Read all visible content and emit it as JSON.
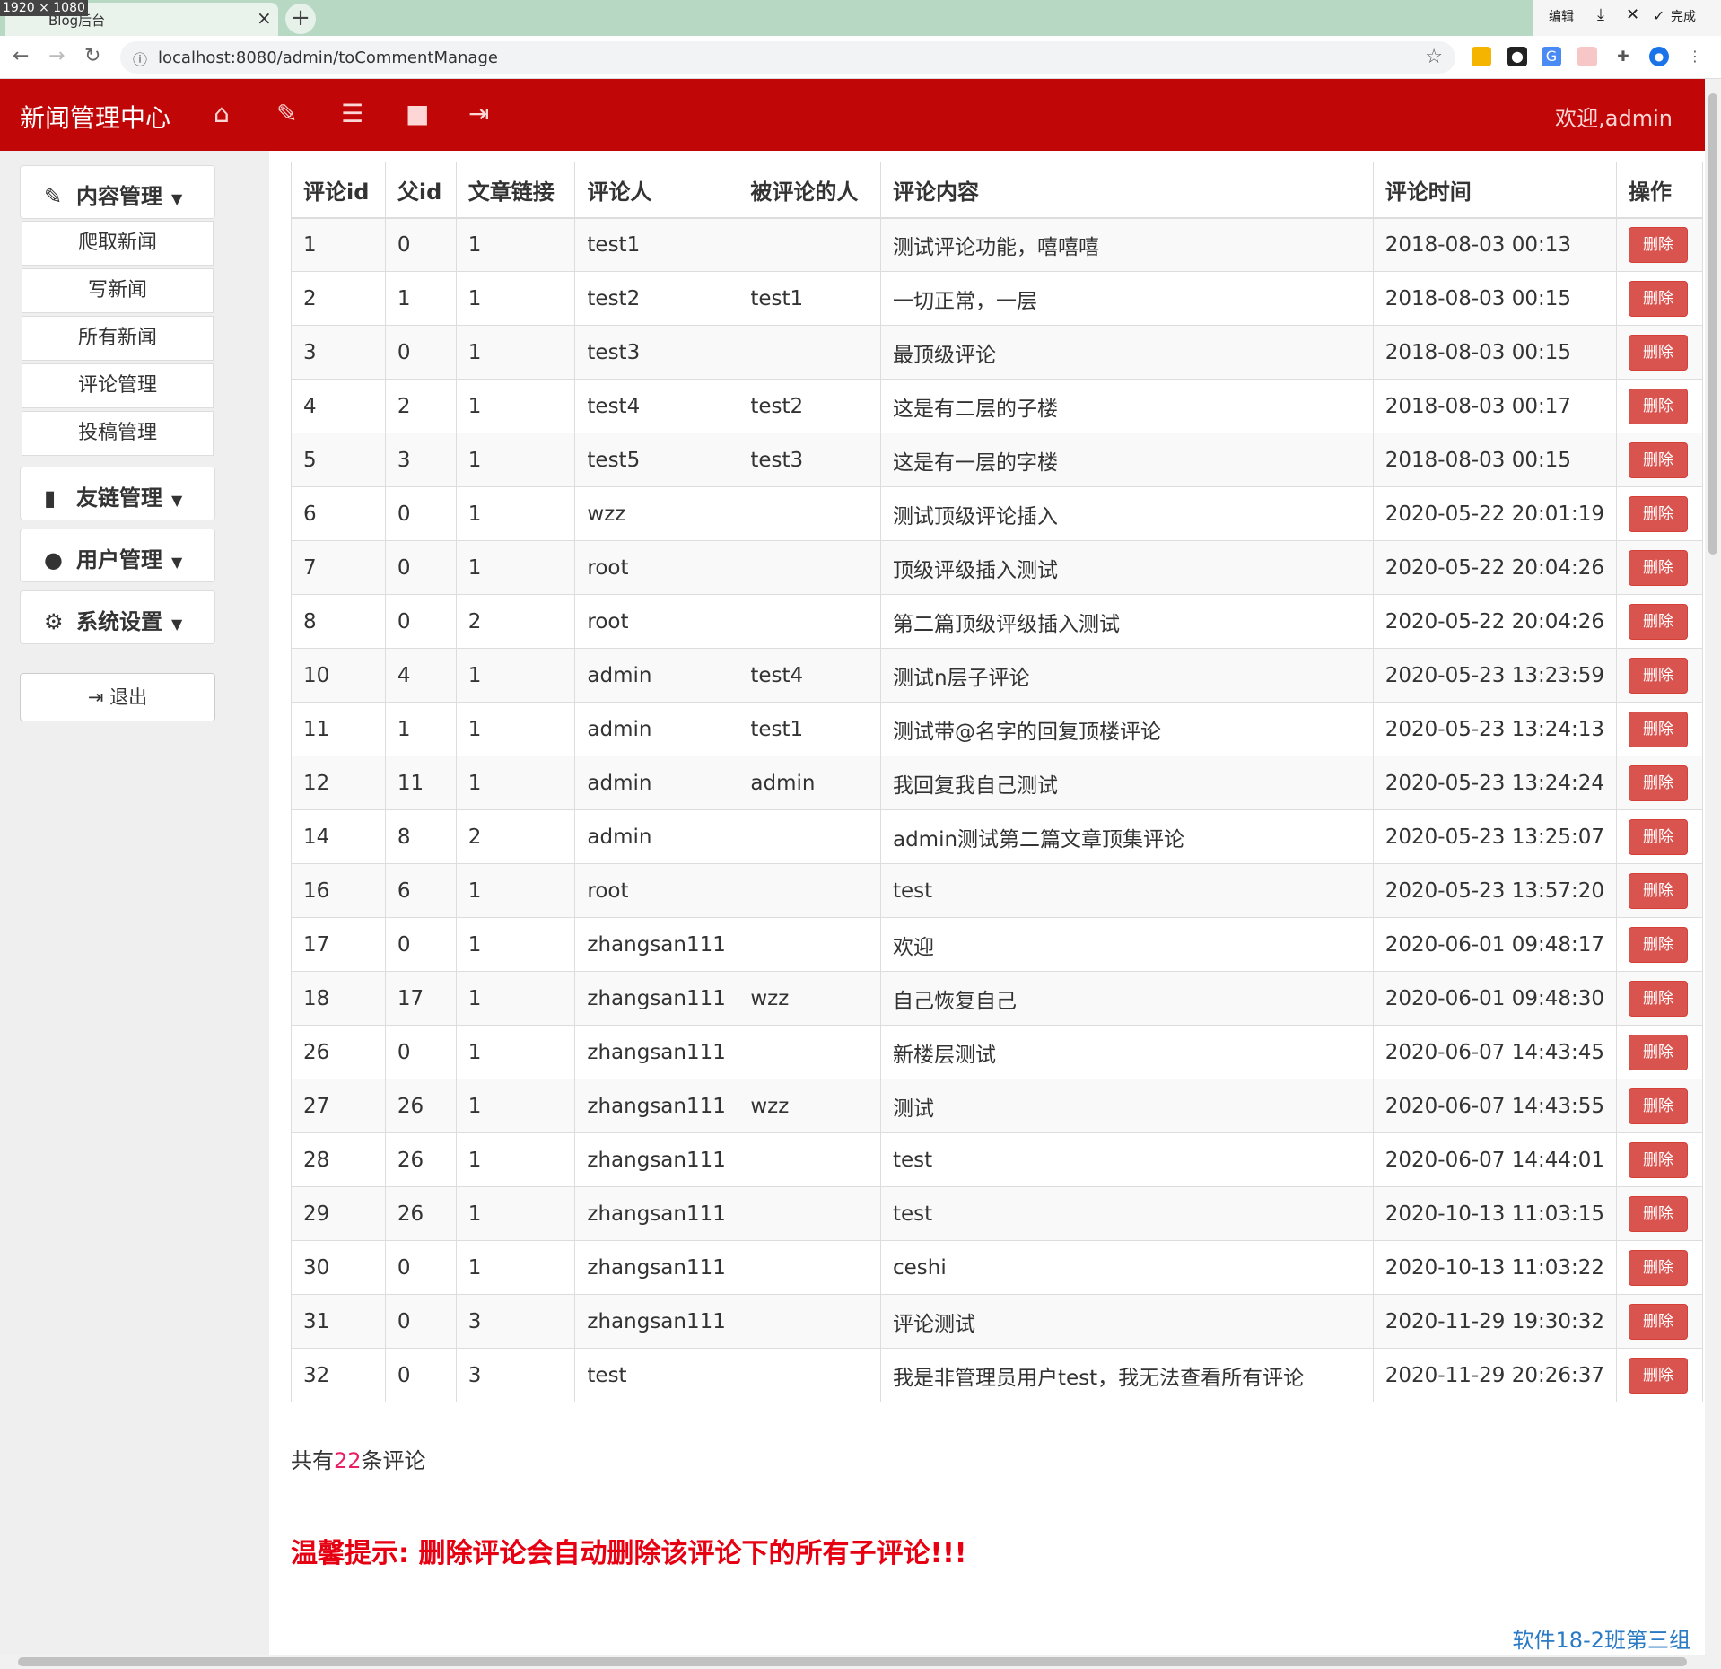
{
  "browser": {
    "dimensions_badge": "1920 × 1080",
    "tab_title": "Blog后台",
    "url": "localhost:8080/admin/toCommentManage",
    "window_controls": {
      "edit": "编辑",
      "done": "完成"
    }
  },
  "header": {
    "brand": "新闻管理中心",
    "welcome": "欢迎,admin"
  },
  "sidebar": {
    "content_menu": "内容管理",
    "content_items": [
      "爬取新闻",
      "写新闻",
      "所有新闻",
      "评论管理",
      "投稿管理"
    ],
    "links_menu": "友链管理",
    "users_menu": "用户管理",
    "settings_menu": "系统设置",
    "logout": "退出"
  },
  "table": {
    "columns": [
      "评论id",
      "父id",
      "文章链接",
      "评论人",
      "被评论的人",
      "评论内容",
      "评论时间",
      "操作"
    ],
    "delete_label": "删除",
    "rows": [
      [
        "1",
        "0",
        "1",
        "test1",
        "",
        "测试评论功能，嘻嘻嘻",
        "2018-08-03 00:13"
      ],
      [
        "2",
        "1",
        "1",
        "test2",
        "test1",
        "一切正常，一层",
        "2018-08-03 00:15"
      ],
      [
        "3",
        "0",
        "1",
        "test3",
        "",
        "最顶级评论",
        "2018-08-03 00:15"
      ],
      [
        "4",
        "2",
        "1",
        "test4",
        "test2",
        "这是有二层的子楼",
        "2018-08-03 00:17"
      ],
      [
        "5",
        "3",
        "1",
        "test5",
        "test3",
        "这是有一层的字楼",
        "2018-08-03 00:15"
      ],
      [
        "6",
        "0",
        "1",
        "wzz",
        "",
        "测试顶级评论插入",
        "2020-05-22 20:01:19"
      ],
      [
        "7",
        "0",
        "1",
        "root",
        "",
        "顶级评级插入测试",
        "2020-05-22 20:04:26"
      ],
      [
        "8",
        "0",
        "2",
        "root",
        "",
        "第二篇顶级评级插入测试",
        "2020-05-22 20:04:26"
      ],
      [
        "10",
        "4",
        "1",
        "admin",
        "test4",
        "测试n层子评论",
        "2020-05-23 13:23:59"
      ],
      [
        "11",
        "1",
        "1",
        "admin",
        "test1",
        "测试带@名字的回复顶楼评论",
        "2020-05-23 13:24:13"
      ],
      [
        "12",
        "11",
        "1",
        "admin",
        "admin",
        "我回复我自己测试",
        "2020-05-23 13:24:24"
      ],
      [
        "14",
        "8",
        "2",
        "admin",
        "",
        "admin测试第二篇文章顶集评论",
        "2020-05-23 13:25:07"
      ],
      [
        "16",
        "6",
        "1",
        "root",
        "",
        "test",
        "2020-05-23 13:57:20"
      ],
      [
        "17",
        "0",
        "1",
        "zhangsan111",
        "",
        "欢迎",
        "2020-06-01 09:48:17"
      ],
      [
        "18",
        "17",
        "1",
        "zhangsan111",
        "wzz",
        "自己恢复自己",
        "2020-06-01 09:48:30"
      ],
      [
        "26",
        "0",
        "1",
        "zhangsan111",
        "",
        "新楼层测试",
        "2020-06-07 14:43:45"
      ],
      [
        "27",
        "26",
        "1",
        "zhangsan111",
        "wzz",
        "测试",
        "2020-06-07 14:43:55"
      ],
      [
        "28",
        "26",
        "1",
        "zhangsan111",
        "",
        "test",
        "2020-06-07 14:44:01"
      ],
      [
        "29",
        "26",
        "1",
        "zhangsan111",
        "",
        "test",
        "2020-10-13 11:03:15"
      ],
      [
        "30",
        "0",
        "1",
        "zhangsan111",
        "",
        "ceshi",
        "2020-10-13 11:03:22"
      ],
      [
        "31",
        "0",
        "3",
        "zhangsan111",
        "",
        "评论测试",
        "2020-11-29 19:30:32"
      ],
      [
        "32",
        "0",
        "3",
        "test",
        "",
        "我是非管理员用户test，我无法查看所有评论",
        "2020-11-29 20:26:37"
      ]
    ]
  },
  "summary": {
    "prefix": "共有",
    "count": "22",
    "suffix": "条评论"
  },
  "tip": "温馨提示: 删除评论会自动删除该评论下的所有子评论!!!",
  "footer": "软件18-2班第三组",
  "colors": {
    "header_bg": "#c00606",
    "delete_btn": "#d9534f",
    "tip": "#e60012",
    "footer": "#2a7ac4"
  }
}
